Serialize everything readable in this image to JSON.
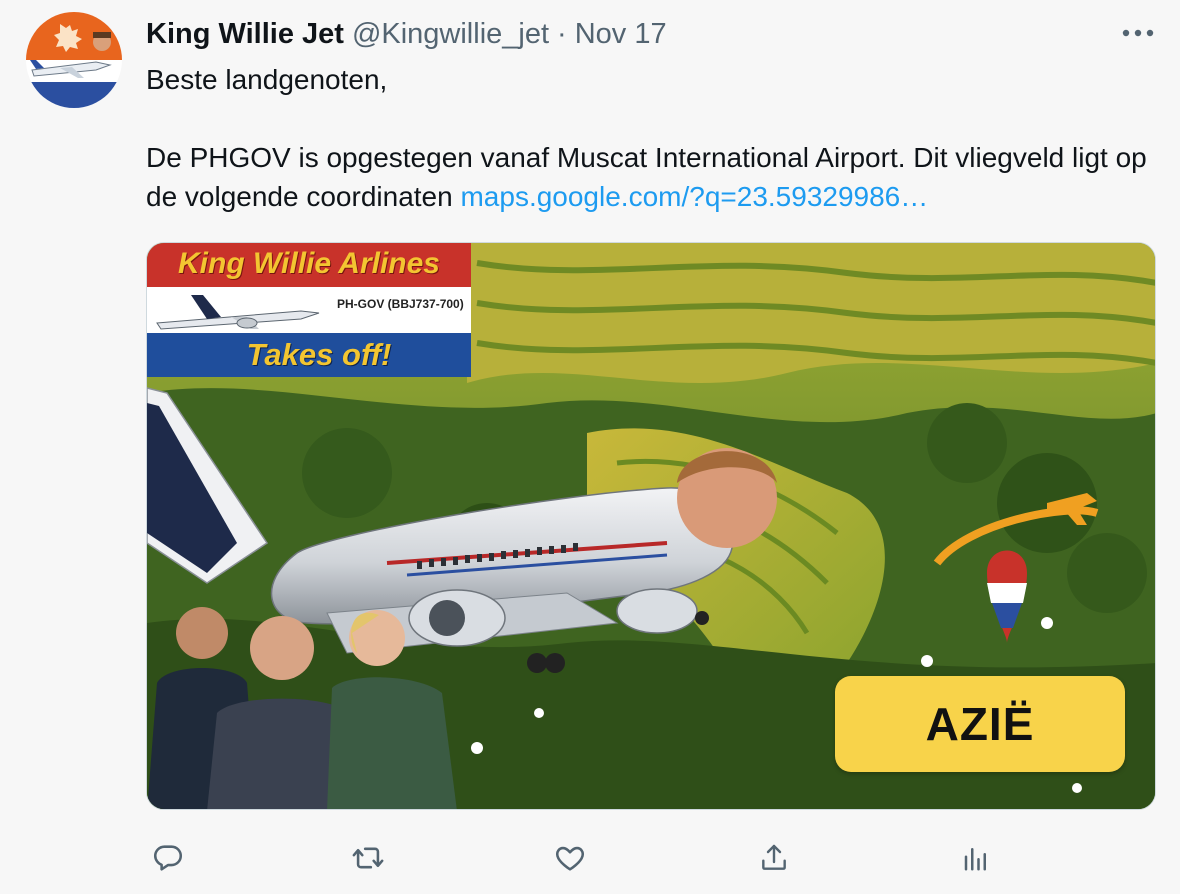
{
  "tweet": {
    "author": {
      "display_name": "King Willie Jet",
      "handle": "@Kingwillie_jet"
    },
    "separator": "·",
    "date": "Nov 17",
    "text": {
      "line1": "Beste landgenoten,",
      "line2": "De PHGOV is opgestegen vanaf Muscat International Airport. Dit vliegveld ligt op de volgende coordinaten",
      "link": "maps.google.com/?q=23.59329986…"
    },
    "media": {
      "banner_title": "King Willie Arlines",
      "banner_registration": "PH-GOV (BBJ737-700)",
      "banner_subtitle": "Takes off!",
      "badge": "AZIË"
    }
  },
  "icons": {
    "more": "more-icon",
    "reply": "reply-icon",
    "retweet": "retweet-icon",
    "like": "like-icon",
    "share": "share-icon",
    "analytics": "analytics-icon"
  },
  "colors": {
    "link": "#1d9bf0",
    "secondary_text": "#536471",
    "icon": "#536471",
    "badge": "#f8d34a",
    "banner_red": "#c8322a",
    "banner_blue": "#1f4e9c",
    "banner_text": "#f3c531"
  }
}
